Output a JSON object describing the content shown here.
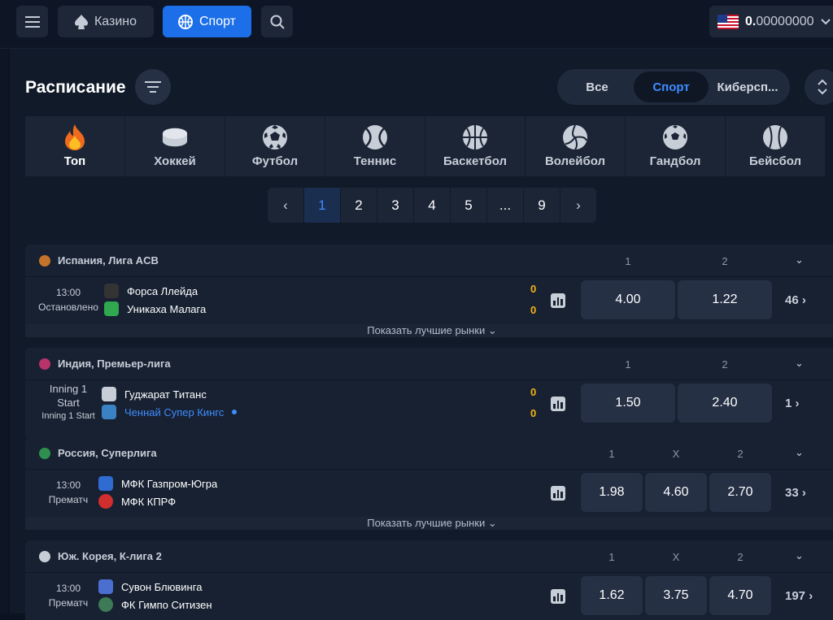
{
  "topbar": {
    "casino_label": "Казино",
    "sport_label": "Спорт",
    "balance_int": "0.",
    "balance_dec": "00000000"
  },
  "header": {
    "title": "Расписание",
    "segments": [
      "Все",
      "Спорт",
      "Киберсп..."
    ],
    "active_segment": "Спорт"
  },
  "sports": [
    {
      "label": "Топ",
      "icon": "fire-icon"
    },
    {
      "label": "Хоккей",
      "icon": "hockey-puck-icon"
    },
    {
      "label": "Футбол",
      "icon": "soccer-ball-icon"
    },
    {
      "label": "Теннис",
      "icon": "tennis-ball-icon"
    },
    {
      "label": "Баскетбол",
      "icon": "basketball-icon"
    },
    {
      "label": "Волейбол",
      "icon": "volleyball-icon"
    },
    {
      "label": "Гандбол",
      "icon": "handball-icon"
    },
    {
      "label": "Бейсбол",
      "icon": "baseball-icon"
    }
  ],
  "pager": {
    "prev": "‹",
    "pages": [
      "1",
      "2",
      "3",
      "4",
      "5",
      "...",
      "9"
    ],
    "next": "›",
    "active": "1"
  },
  "leagues": [
    {
      "name": "Испания, Лига ACB",
      "cols": [
        "1",
        "2"
      ],
      "match": {
        "time": "13:00",
        "status": "Остановлено",
        "team1": "Форса Ллейда",
        "team2": "Уникаха Малага",
        "score1": "0",
        "score2": "0",
        "odds": [
          "4.00",
          "1.22"
        ],
        "more": "46"
      },
      "best_markets": "Показать лучшие рынки"
    },
    {
      "name": "Индия, Премьер-лига",
      "cols": [
        "1",
        "2"
      ],
      "match": {
        "time": "Inning 1 Start",
        "status": "Inning 1 Start",
        "team1": "Гуджарат Титанс",
        "team2": "Ченнай Супер Кингс",
        "score1": "0",
        "score2": "0",
        "odds": [
          "1.50",
          "2.40"
        ],
        "more": "1"
      }
    },
    {
      "name": "Россия, Суперлига",
      "cols": [
        "1",
        "X",
        "2"
      ],
      "match": {
        "time": "13:00",
        "status": "Прематч",
        "team1": "МФК Газпром-Югра",
        "team2": "МФК КПРФ",
        "odds": [
          "1.98",
          "4.60",
          "2.70"
        ],
        "more": "33"
      },
      "best_markets": "Показать лучшие рынки"
    },
    {
      "name": "Юж. Корея, К-лига 2",
      "cols": [
        "1",
        "X",
        "2"
      ],
      "match": {
        "time": "13:00",
        "status": "Прематч",
        "team1": "Сувон Блювинга",
        "team2": "ФК Гимпо Ситизен",
        "odds": [
          "1.62",
          "3.75",
          "4.70"
        ],
        "more": "197"
      }
    }
  ],
  "colors": {
    "accent": "#1c6fe8",
    "score": "#f5b316",
    "link": "#3f8cff"
  }
}
